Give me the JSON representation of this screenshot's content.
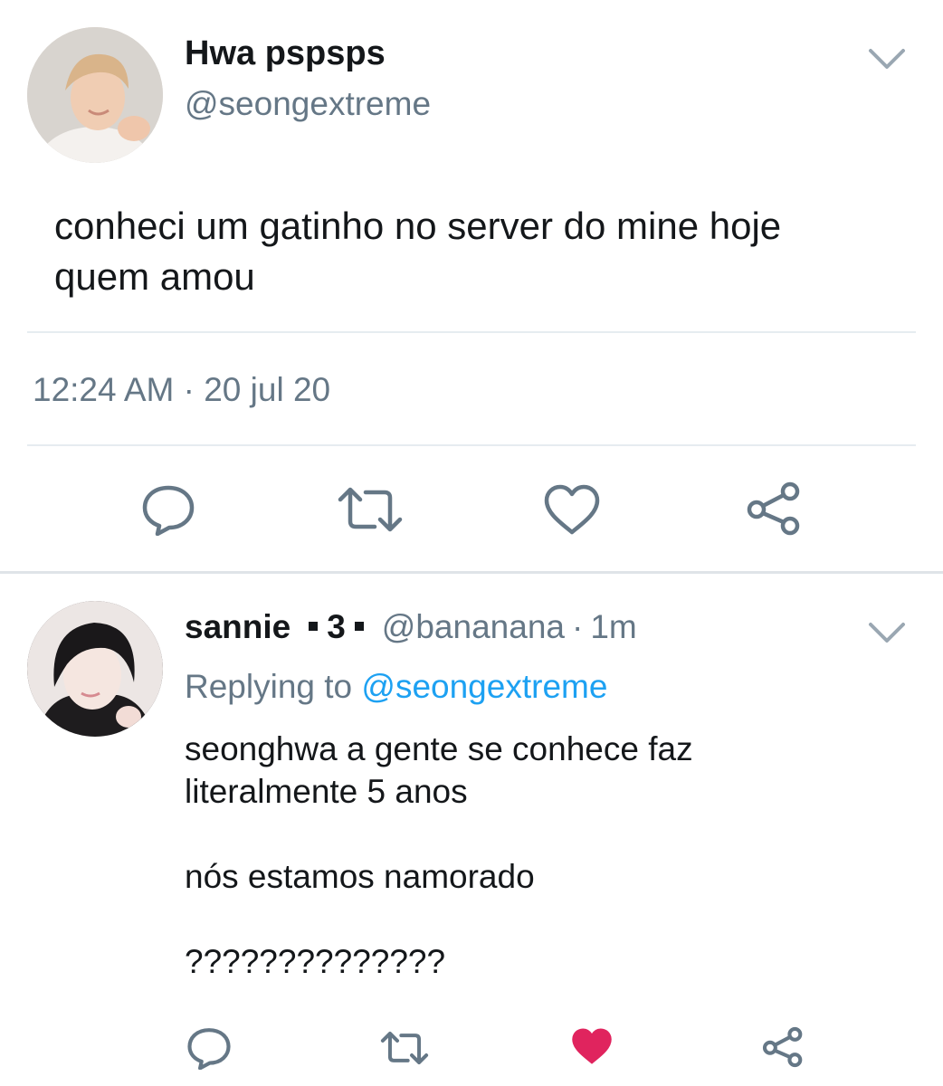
{
  "colors": {
    "text_primary": "#14171a",
    "text_secondary": "#657786",
    "link_blue": "#1da1f2",
    "icon_gray": "#657786",
    "like_red": "#e0245e",
    "divider": "#e6ecf0"
  },
  "main_tweet": {
    "display_name": "Hwa pspsps",
    "handle": "@seongextreme",
    "text_lines": [
      "conheci um gatinho no server do mine hoje",
      "quem amou"
    ],
    "timestamp": "12:24 AM · 20 jul 20",
    "actions": {
      "reply_icon": "comment-icon",
      "retweet_icon": "retweet-icon",
      "like_icon": "heart-outline-icon",
      "share_icon": "share-icon"
    }
  },
  "reply_tweet": {
    "display_name": "sannie",
    "badge": "3",
    "handle": "@bananana",
    "separator": "·",
    "time": "1m",
    "replying_prefix": "Replying to",
    "replying_to": "@seongextreme",
    "text_lines": [
      "seonghwa a gente se conhece faz",
      "literalmente 5 anos",
      "",
      "nós estamos namorado",
      "",
      "??????????????"
    ],
    "liked": true,
    "actions": {
      "reply_icon": "comment-icon",
      "retweet_icon": "retweet-icon",
      "like_icon": "heart-filled-icon",
      "share_icon": "share-icon"
    }
  }
}
